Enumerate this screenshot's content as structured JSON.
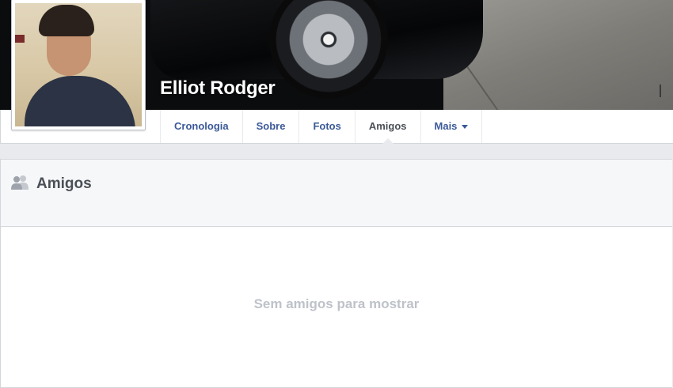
{
  "profile": {
    "name": "Elliot Rodger"
  },
  "nav": {
    "tabs": [
      {
        "label": "Cronologia"
      },
      {
        "label": "Sobre"
      },
      {
        "label": "Fotos"
      },
      {
        "label": "Amigos"
      },
      {
        "label": "Mais"
      }
    ],
    "active_tab": "Amigos"
  },
  "friends_section": {
    "title": "Amigos",
    "icon": "friends-icon",
    "empty_message": "Sem amigos para mostrar"
  },
  "colors": {
    "link": "#3b5998",
    "active_tab_text": "#4b4f56",
    "empty_text": "#bec2c9",
    "page_background": "#e9eaed"
  }
}
